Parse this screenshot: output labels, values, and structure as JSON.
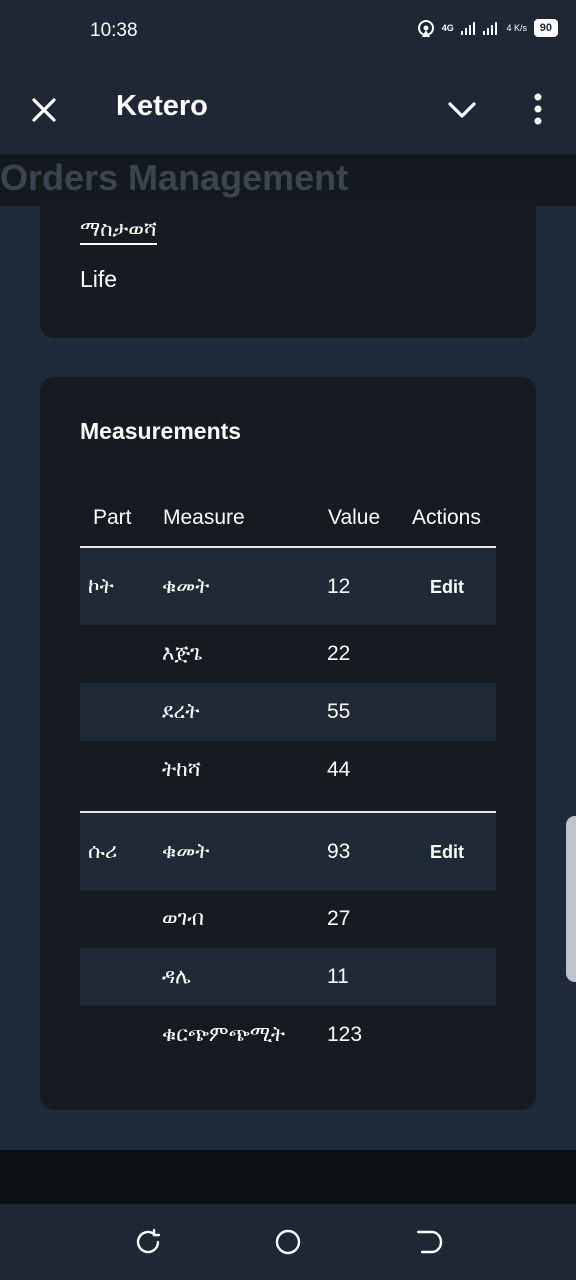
{
  "status_bar": {
    "time": "10:38",
    "network": "4G",
    "speed": "4 K/s",
    "battery": "90",
    "icons": [
      "hotspot-icon",
      "signal-icon",
      "signal-icon",
      "battery-icon"
    ]
  },
  "app_bar": {
    "title": "Ketero",
    "icons": [
      "close-icon",
      "chevron-down-icon",
      "more-vertical-icon"
    ]
  },
  "section_banner": "Orders Management",
  "details_card": {
    "field_label": "ማስታወሻ",
    "field_value": "Life"
  },
  "measurements": {
    "title": "Measurements",
    "columns": [
      "Part",
      "Measure",
      "Value",
      "Actions"
    ],
    "edit_label": "Edit",
    "groups": [
      {
        "part": "ኮት",
        "rows": [
          {
            "measure": "ቁመት",
            "value": "12"
          },
          {
            "measure": "እጅጌ",
            "value": "22"
          },
          {
            "measure": "ደረት",
            "value": "55"
          },
          {
            "measure": "ትከሻ",
            "value": "44"
          }
        ]
      },
      {
        "part": "ሱሪ",
        "rows": [
          {
            "measure": "ቁመት",
            "value": "93"
          },
          {
            "measure": "ወገብ",
            "value": "27"
          },
          {
            "measure": "ዳሌ",
            "value": "11"
          },
          {
            "measure": "ቁርጭምጭሚት",
            "value": "123"
          }
        ]
      }
    ]
  },
  "nav_bar": {
    "icons": [
      "recent-apps-icon",
      "home-icon",
      "back-icon"
    ]
  },
  "colors": {
    "app_bar_bg": "#1e2733",
    "content_bg": "#1f2b3b",
    "card_bg": "#161b22",
    "stripe_bg": "#202a36"
  }
}
